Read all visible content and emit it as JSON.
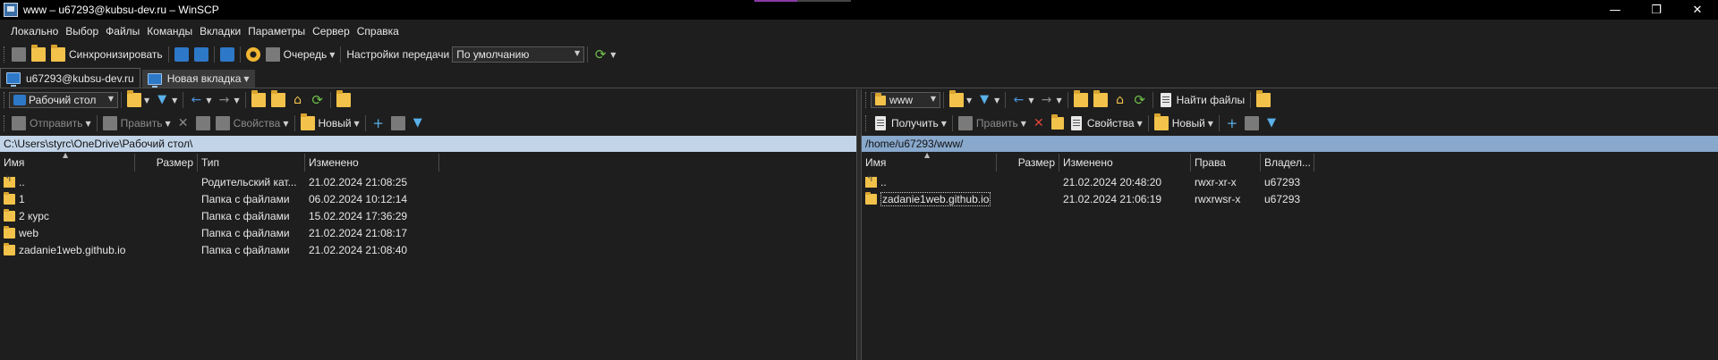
{
  "window": {
    "title": "www – u67293@kubsu-dev.ru – WinSCP",
    "controls": {
      "minimize": "—",
      "restore": "❐",
      "close": "✕"
    }
  },
  "menu": [
    "Локально",
    "Выбор",
    "Файлы",
    "Команды",
    "Вкладки",
    "Параметры",
    "Сервер",
    "Справка"
  ],
  "main_toolbar": {
    "sync_label": "Синхронизировать",
    "queue_label": "Очередь",
    "transfer_settings_label": "Настройки передачи",
    "transfer_settings_value": "По умолчанию"
  },
  "tabs": [
    {
      "label": "u67293@kubsu-dev.ru",
      "active": true
    },
    {
      "label": "Новая вкладка",
      "active": false
    }
  ],
  "local": {
    "location_select": "Рабочий стол",
    "actions": {
      "send": "Отправить",
      "edit": "Править",
      "properties": "Свойства",
      "new": "Новый"
    },
    "path": "C:\\Users\\styrc\\OneDrive\\Рабочий стол\\",
    "columns": [
      "Имя",
      "Размер",
      "Тип",
      "Изменено"
    ],
    "rows": [
      {
        "name": "..",
        "size": "",
        "type": "Родительский кат...",
        "modified": "21.02.2024 21:08:25",
        "updir": true
      },
      {
        "name": "1",
        "size": "",
        "type": "Папка с файлами",
        "modified": "06.02.2024 10:12:14",
        "updir": false
      },
      {
        "name": "2 курс",
        "size": "",
        "type": "Папка с файлами",
        "modified": "15.02.2024 17:36:29",
        "updir": false
      },
      {
        "name": "web",
        "size": "",
        "type": "Папка с файлами",
        "modified": "21.02.2024 21:08:17",
        "updir": false
      },
      {
        "name": "zadanie1web.github.io",
        "size": "",
        "type": "Папка с файлами",
        "modified": "21.02.2024 21:08:40",
        "updir": false
      }
    ]
  },
  "remote": {
    "location_select": "www",
    "find_files_label": "Найти файлы",
    "actions": {
      "receive": "Получить",
      "edit": "Править",
      "properties": "Свойства",
      "new": "Новый"
    },
    "path": "/home/u67293/www/",
    "columns": [
      "Имя",
      "Размер",
      "Изменено",
      "Права",
      "Владел..."
    ],
    "rows": [
      {
        "name": "..",
        "size": "",
        "modified": "21.02.2024 20:48:20",
        "rights": "rwxr-xr-x",
        "owner": "u67293",
        "updir": true
      },
      {
        "name": "zadanie1web.github.io",
        "size": "",
        "modified": "21.02.2024 21:06:19",
        "rights": "rwxrwsr-x",
        "owner": "u67293",
        "updir": false
      }
    ]
  }
}
